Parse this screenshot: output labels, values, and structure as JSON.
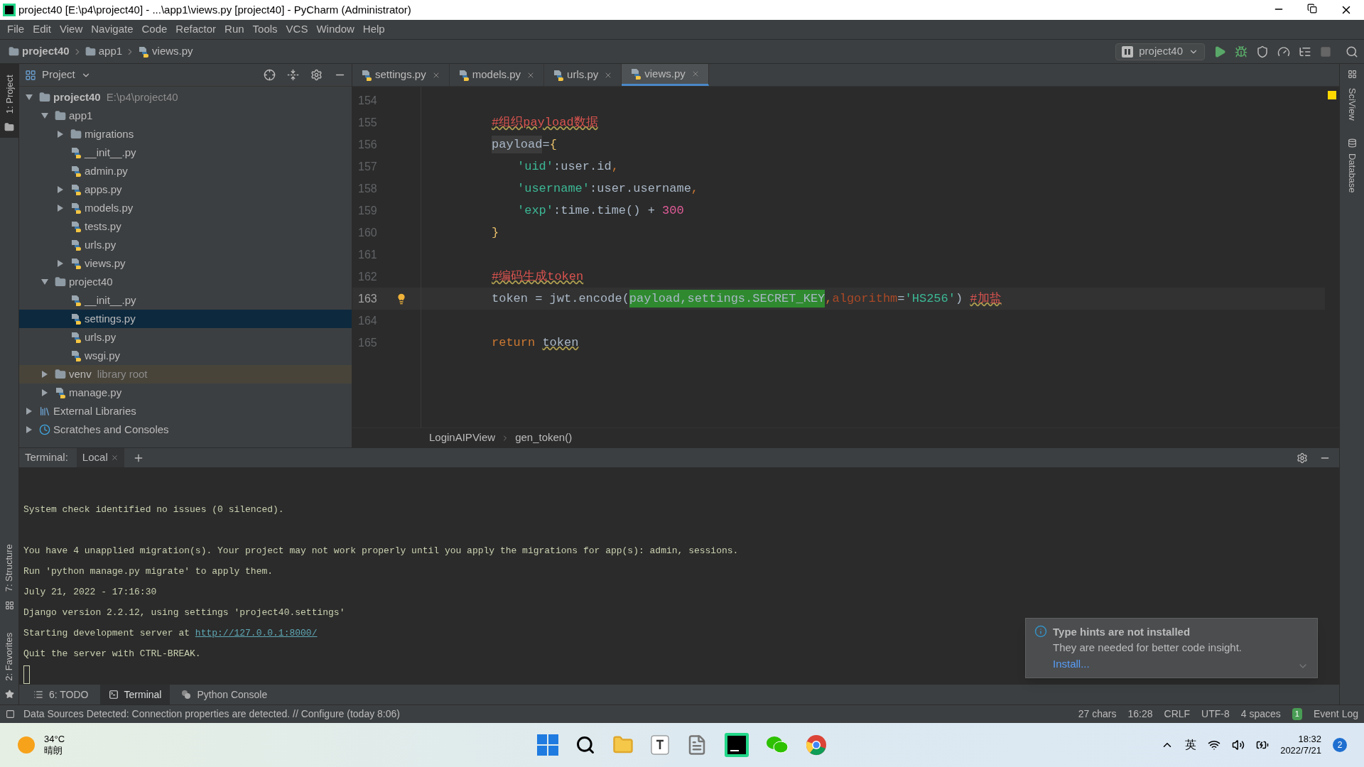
{
  "window": {
    "title": "project40 [E:\\p4\\project40] - ...\\app1\\views.py [project40] - PyCharm (Administrator)"
  },
  "menu": [
    "File",
    "Edit",
    "View",
    "Navigate",
    "Code",
    "Refactor",
    "Run",
    "Tools",
    "VCS",
    "Window",
    "Help"
  ],
  "navbar": {
    "crumbs": [
      "project40",
      "app1",
      "views.py"
    ],
    "run_config": "project40"
  },
  "side_left": {
    "top": "1: Project",
    "bottom": [
      "7: Structure",
      "2: Favorites"
    ]
  },
  "side_right": [
    "SciView",
    "Database"
  ],
  "project_panel": {
    "title": "Project"
  },
  "tree": {
    "items": [
      {
        "label": "project40",
        "hint": "E:\\p4\\project40",
        "kind": "root",
        "expanded": true,
        "selected": false,
        "children": [
          {
            "label": "app1",
            "kind": "module",
            "expanded": true,
            "selected": false,
            "children": [
              {
                "label": "migrations",
                "kind": "module",
                "expanded": false,
                "selected": false
              },
              {
                "label": "__init__.py",
                "kind": "file",
                "selected": false
              },
              {
                "label": "admin.py",
                "kind": "file",
                "selected": false
              },
              {
                "label": "apps.py",
                "kind": "file",
                "expanded": false,
                "selected": false
              },
              {
                "label": "models.py",
                "kind": "file",
                "expanded": false,
                "selected": false
              },
              {
                "label": "tests.py",
                "kind": "file",
                "selected": false
              },
              {
                "label": "urls.py",
                "kind": "file",
                "selected": false
              },
              {
                "label": "views.py",
                "kind": "file",
                "expanded": false,
                "selected": false
              }
            ]
          },
          {
            "label": "project40",
            "kind": "module",
            "expanded": true,
            "selected": false,
            "children": [
              {
                "label": "__init__.py",
                "kind": "file",
                "selected": false
              },
              {
                "label": "settings.py",
                "kind": "file",
                "selected": true
              },
              {
                "label": "urls.py",
                "kind": "file",
                "selected": false
              },
              {
                "label": "wsgi.py",
                "kind": "file",
                "selected": false
              }
            ]
          },
          {
            "label": "venv",
            "hint": "library root",
            "kind": "library",
            "expanded": false,
            "selected": false
          },
          {
            "label": "manage.py",
            "kind": "file",
            "expanded": false,
            "selected": false
          }
        ]
      },
      {
        "label": "External Libraries",
        "kind": "libraries",
        "expanded": false,
        "selected": false
      },
      {
        "label": "Scratches and Consoles",
        "kind": "scratches",
        "expanded": false,
        "selected": false
      }
    ]
  },
  "tabs": [
    {
      "label": "settings.py",
      "selected": false
    },
    {
      "label": "models.py",
      "selected": false
    },
    {
      "label": "urls.py",
      "selected": false
    },
    {
      "label": "views.py",
      "selected": true
    }
  ],
  "code": [
    {
      "number": "154",
      "kind": "plain",
      "current": false
    },
    {
      "number": "155",
      "kind": "plain",
      "current": false,
      "tokens": [
        {
          "text": "#组织payload数据",
          "kind": "comment"
        }
      ]
    },
    {
      "number": "156",
      "kind": "plain",
      "current": false,
      "tokens": [
        {
          "text": "payload",
          "kind": "var"
        },
        {
          "text": "=",
          "kind": "op"
        },
        {
          "text": "{",
          "kind": "brace"
        }
      ]
    },
    {
      "number": "157",
      "kind": "nested",
      "current": false,
      "tokens": [
        {
          "text": "'uid'",
          "kind": "string"
        },
        {
          "text": ":",
          "kind": "op"
        },
        {
          "text": "user.id",
          "kind": "plain"
        },
        {
          "text": ",",
          "kind": "punct"
        }
      ]
    },
    {
      "number": "158",
      "kind": "nested",
      "current": false,
      "tokens": [
        {
          "text": "'username'",
          "kind": "string"
        },
        {
          "text": ":",
          "kind": "op"
        },
        {
          "text": "user.username",
          "kind": "plain"
        },
        {
          "text": ",",
          "kind": "punct"
        }
      ]
    },
    {
      "number": "159",
      "kind": "nested",
      "current": false,
      "tokens": [
        {
          "text": "'exp'",
          "kind": "string"
        },
        {
          "text": ":",
          "kind": "op"
        },
        {
          "text": "time.time",
          "kind": "plain"
        },
        {
          "text": "() + ",
          "kind": "op"
        },
        {
          "text": "300",
          "kind": "number"
        }
      ]
    },
    {
      "number": "160",
      "kind": "plain",
      "current": false,
      "tokens": [
        {
          "text": "}",
          "kind": "brace"
        }
      ]
    },
    {
      "number": "161",
      "kind": "plain",
      "current": false
    },
    {
      "number": "162",
      "kind": "plain",
      "current": false,
      "tokens": [
        {
          "text": "#编码生成token",
          "kind": "comment"
        }
      ]
    },
    {
      "number": "163",
      "kind": "plain",
      "current": true,
      "tokens": [
        {
          "text": "token = jwt.encode(",
          "kind": "plain"
        },
        {
          "text": "payload,settings.SECRET_KEY",
          "kind": "highlight"
        },
        {
          "text": ",",
          "kind": "punct"
        },
        {
          "text": "algorithm",
          "kind": "param"
        },
        {
          "text": "=",
          "kind": "plain"
        },
        {
          "text": "'HS256'",
          "kind": "string"
        },
        {
          "text": ") ",
          "kind": "plain"
        },
        {
          "text": "#加盐",
          "kind": "comment"
        }
      ]
    },
    {
      "number": "164",
      "kind": "plain",
      "current": false
    },
    {
      "number": "165",
      "kind": "plain",
      "current": false,
      "tokens": [
        {
          "text": "return",
          "kind": "keyword"
        },
        {
          "text": "token",
          "kind": "warned"
        }
      ]
    }
  ],
  "editor_breadcrumb": [
    "LoginAIPView",
    "gen_token()"
  ],
  "terminal": {
    "label": "Terminal:",
    "tabs": [
      {
        "label": "Local",
        "selected": true
      }
    ],
    "lines": [
      {
        "kind": "blank"
      },
      {
        "kind": "text",
        "text": "System check identified no issues (0 silenced)."
      },
      {
        "kind": "blank"
      },
      {
        "kind": "text",
        "text": "You have 4 unapplied migration(s). Your project may not work properly until you apply the migrations for app(s): admin, sessions."
      },
      {
        "kind": "text",
        "text": "Run 'python manage.py migrate' to apply them."
      },
      {
        "kind": "text",
        "text": "July 21, 2022 - 17:16:30"
      },
      {
        "kind": "text",
        "text": "Django version 2.2.12, using settings 'project40.settings'"
      },
      {
        "kind": "text",
        "text": "Starting development server at ",
        "link": "http://127.0.0.1:8000/"
      },
      {
        "kind": "text",
        "text": "Quit the server with CTRL-BREAK."
      }
    ]
  },
  "notification": {
    "title": "Type hints are not installed",
    "body": "They are needed for better code insight.",
    "action": "Install..."
  },
  "tool_tabs": [
    {
      "label": "6: TODO",
      "kind": "list",
      "selected": false
    },
    {
      "label": "Terminal",
      "kind": "terminal",
      "selected": true
    },
    {
      "label": "Python Console",
      "kind": "python",
      "selected": false
    }
  ],
  "status_bar": {
    "message": "Data Sources Detected: Connection properties are detected. // Configure (today 8:06)",
    "event_log": "Event Log",
    "event_count": "1",
    "items": [
      "27 chars",
      "16:28",
      "CRLF",
      "UTF-8",
      "4 spaces"
    ]
  },
  "taskbar": {
    "temperature": "34°C",
    "weather": "晴朗",
    "ime": "英",
    "time": "18:32",
    "date": "2022/7/21",
    "notifications": "2"
  }
}
